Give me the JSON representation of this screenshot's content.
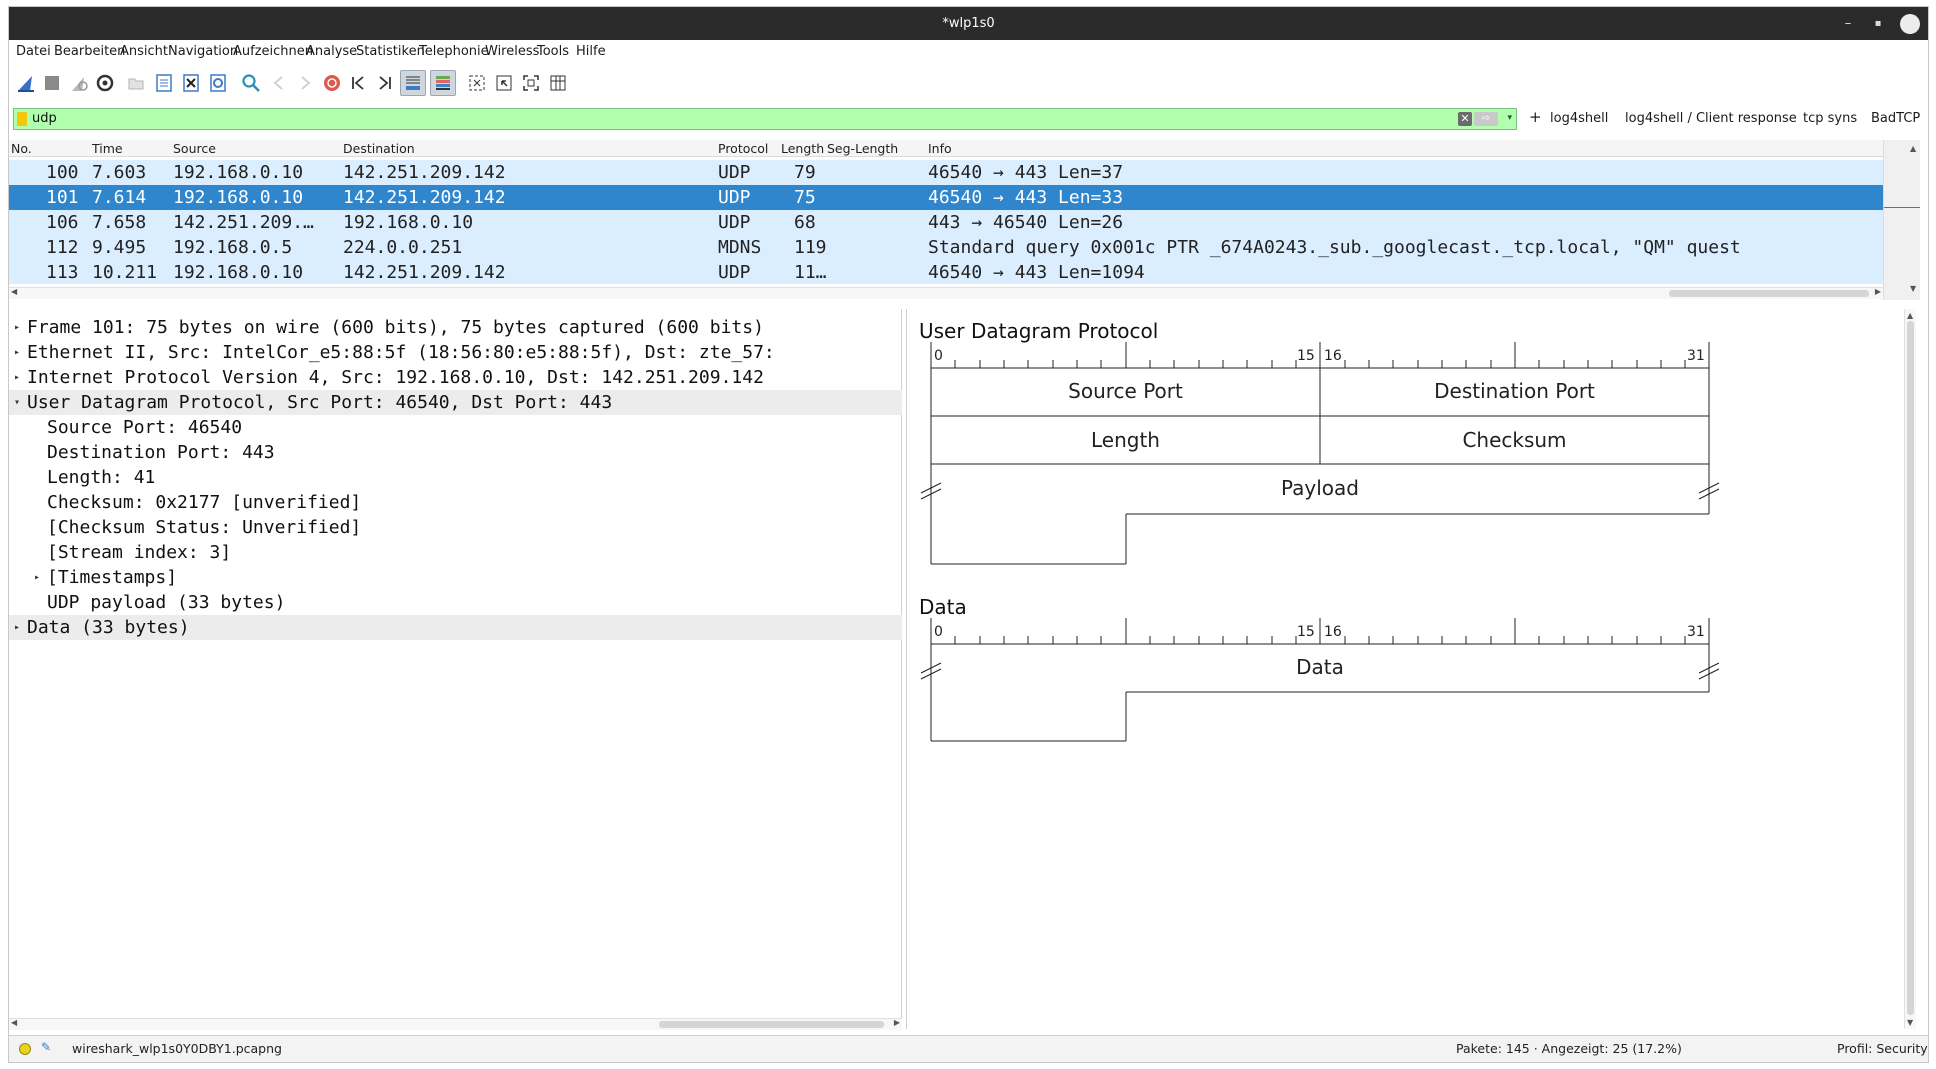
{
  "window": {
    "title": "*wlp1s0"
  },
  "menu": [
    "Datei",
    "Bearbeiten",
    "Ansicht",
    "Navigation",
    "Aufzeichnen",
    "Analyse",
    "Statistiken",
    "Telephonie",
    "Wireless",
    "Tools",
    "Hilfe"
  ],
  "toolbar": {
    "icons": [
      "shark-fin-start-icon",
      "stop-capture-icon",
      "restart-capture-icon",
      "capture-options-icon",
      "open-file-icon",
      "save-file-icon",
      "close-file-icon",
      "reload-file-icon",
      "find-packet-icon",
      "go-back-icon",
      "go-forward-icon",
      "go-to-packet-icon",
      "first-packet-icon",
      "last-packet-icon",
      "auto-scroll-icon",
      "colorize-icon",
      "zoom-in-icon",
      "zoom-out-icon",
      "normal-size-icon",
      "resize-columns-icon"
    ]
  },
  "filter": {
    "value": "udp",
    "buttons": [
      "log4shell",
      "log4shell / Client response",
      "tcp syns",
      "BadTCP"
    ]
  },
  "packet_list": {
    "columns": [
      "No.",
      "Time",
      "Source",
      "Destination",
      "Protocol",
      "Length",
      "Seg-Length",
      "Info"
    ],
    "rows": [
      {
        "no": "100",
        "time": "7.603",
        "src": "192.168.0.10",
        "dst": "142.251.209.142",
        "proto": "UDP",
        "len": "79",
        "seglen": "",
        "info": "46540 → 443 Len=37",
        "selected": false
      },
      {
        "no": "101",
        "time": "7.614",
        "src": "192.168.0.10",
        "dst": "142.251.209.142",
        "proto": "UDP",
        "len": "75",
        "seglen": "",
        "info": "46540 → 443 Len=33",
        "selected": true
      },
      {
        "no": "106",
        "time": "7.658",
        "src": "142.251.209.…",
        "dst": "192.168.0.10",
        "proto": "UDP",
        "len": "68",
        "seglen": "",
        "info": "443 → 46540 Len=26",
        "selected": false
      },
      {
        "no": "112",
        "time": "9.495",
        "src": "192.168.0.5",
        "dst": "224.0.0.251",
        "proto": "MDNS",
        "len": "119",
        "seglen": "",
        "info": "Standard query 0x001c PTR _674A0243._sub._googlecast._tcp.local, \"QM\" quest",
        "selected": false
      },
      {
        "no": "113",
        "time": "10.211",
        "src": "192.168.0.10",
        "dst": "142.251.209.142",
        "proto": "UDP",
        "len": "11…",
        "seglen": "",
        "info": "46540 → 443 Len=1094",
        "selected": false
      }
    ]
  },
  "details": [
    {
      "text": "Frame 101: 75 bytes on wire (600 bits), 75 bytes captured (600 bits)",
      "level": 0,
      "arrow": "right",
      "grey": false
    },
    {
      "text": "Ethernet II, Src: IntelCor_e5:88:5f (18:56:80:e5:88:5f), Dst: zte_57:",
      "level": 0,
      "arrow": "right",
      "grey": false
    },
    {
      "text": "Internet Protocol Version 4, Src: 192.168.0.10, Dst: 142.251.209.142",
      "level": 0,
      "arrow": "right",
      "grey": false
    },
    {
      "text": "User Datagram Protocol, Src Port: 46540, Dst Port: 443",
      "level": 0,
      "arrow": "down",
      "grey": true
    },
    {
      "text": "Source Port: 46540",
      "level": 1,
      "arrow": "",
      "grey": false
    },
    {
      "text": "Destination Port: 443",
      "level": 1,
      "arrow": "",
      "grey": false
    },
    {
      "text": "Length: 41",
      "level": 1,
      "arrow": "",
      "grey": false
    },
    {
      "text": "Checksum: 0x2177 [unverified]",
      "level": 1,
      "arrow": "",
      "grey": false
    },
    {
      "text": "[Checksum Status: Unverified]",
      "level": 1,
      "arrow": "",
      "grey": false
    },
    {
      "text": "[Stream index: 3]",
      "level": 1,
      "arrow": "",
      "grey": false
    },
    {
      "text": "[Timestamps]",
      "level": 1,
      "arrow": "right",
      "grey": false
    },
    {
      "text": "UDP payload (33 bytes)",
      "level": 1,
      "arrow": "",
      "grey": false
    },
    {
      "text": "Data (33 bytes)",
      "level": 0,
      "arrow": "right",
      "grey": true
    }
  ],
  "diagram": {
    "udp": {
      "title": "User Datagram Protocol",
      "ruler": [
        "0",
        "15",
        "16",
        "31"
      ],
      "fields": [
        "Source Port",
        "Destination Port",
        "Length",
        "Checksum",
        "Payload"
      ]
    },
    "data": {
      "title": "Data",
      "ruler": [
        "0",
        "15",
        "16",
        "31"
      ],
      "fields": [
        "Data"
      ]
    }
  },
  "status": {
    "file": "wireshark_wlp1s0Y0DBY1.pcapng",
    "packets": "Pakete: 145 · Angezeigt: 25 (17.2%)",
    "profile": "Profil: Security"
  }
}
